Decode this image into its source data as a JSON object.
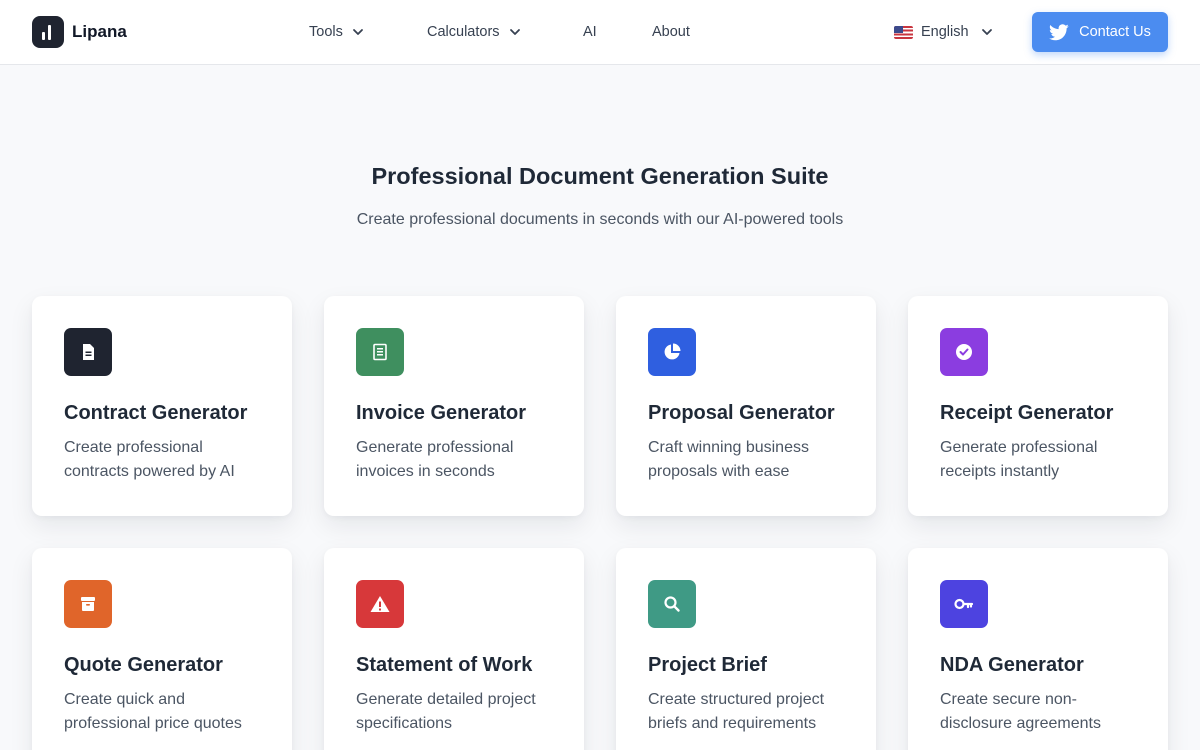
{
  "nav": {
    "logo_text": "Lipana",
    "items": [
      {
        "label": "Tools",
        "has_dropdown": true
      },
      {
        "label": "Calculators",
        "has_dropdown": true
      },
      {
        "label": "AI",
        "has_dropdown": false
      },
      {
        "label": "About",
        "has_dropdown": false
      }
    ],
    "language": "English",
    "language_flag": "us-flag-icon",
    "contact_label": "Contact Us",
    "contact_icon": "twitter-icon",
    "contact_color": "#4b8cf0"
  },
  "hero": {
    "title": "Professional Document Generation Suite",
    "subtitle": "Create professional documents in seconds with our AI-powered tools"
  },
  "cards": [
    {
      "title": "Contract Generator",
      "description": "Create professional contracts powered by AI",
      "icon": "document-icon",
      "color": "#1f2430"
    },
    {
      "title": "Invoice Generator",
      "description": "Generate professional invoices in seconds",
      "icon": "receipt-icon",
      "color": "#3f8f5f"
    },
    {
      "title": "Proposal Generator",
      "description": "Craft winning business proposals with ease",
      "icon": "pie-chart-icon",
      "color": "#2f5fe0"
    },
    {
      "title": "Receipt Generator",
      "description": "Generate professional receipts instantly",
      "icon": "check-circle-icon",
      "color": "#8b3de0"
    },
    {
      "title": "Quote Generator",
      "description": "Create quick and professional price quotes",
      "icon": "archive-icon",
      "color": "#e0652a"
    },
    {
      "title": "Statement of Work",
      "description": "Generate detailed project specifications",
      "icon": "warning-icon",
      "color": "#d7383a"
    },
    {
      "title": "Project Brief",
      "description": "Create structured project briefs and requirements",
      "icon": "search-icon",
      "color": "#3f9a85"
    },
    {
      "title": "NDA Generator",
      "description": "Create secure non-disclosure agreements",
      "icon": "key-icon",
      "color": "#4d43e0"
    }
  ]
}
